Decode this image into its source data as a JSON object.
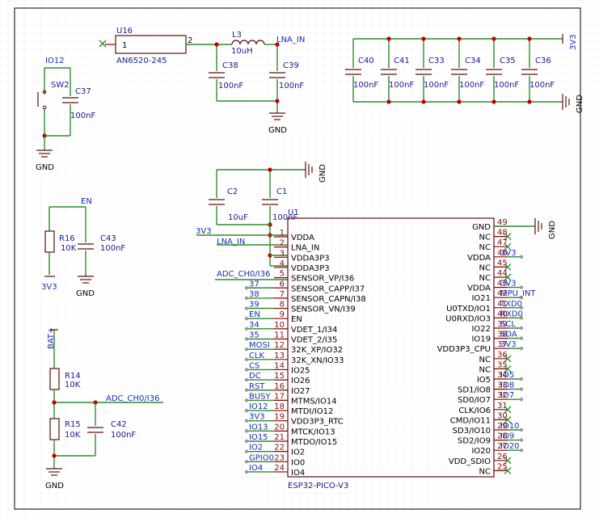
{
  "components": {
    "u16": {
      "ref": "U16",
      "value": "AN6520-245",
      "pin1": "1",
      "pin2": "2"
    },
    "l3": {
      "ref": "L3",
      "value": "10uH"
    },
    "c38": {
      "ref": "C38",
      "value": "100nF"
    },
    "c39": {
      "ref": "C39",
      "value": "100nF"
    },
    "c40": {
      "ref": "C40",
      "value": "100nF"
    },
    "c41": {
      "ref": "C41",
      "value": "100nF"
    },
    "c33": {
      "ref": "C33",
      "value": "100nF"
    },
    "c34": {
      "ref": "C34",
      "value": "100nF"
    },
    "c35": {
      "ref": "C35",
      "value": "100nF"
    },
    "c36": {
      "ref": "C36",
      "value": "100nF"
    },
    "sw2": {
      "ref": "SW2"
    },
    "c37": {
      "ref": "C37",
      "value": "100nF"
    },
    "c2": {
      "ref": "C2",
      "value": "10uF"
    },
    "c1": {
      "ref": "C1",
      "value": "100nF"
    },
    "r16": {
      "ref": "R16",
      "value": "10K"
    },
    "c43": {
      "ref": "C43",
      "value": "100nF"
    },
    "r14": {
      "ref": "R14",
      "value": "10K"
    },
    "r15": {
      "ref": "R15",
      "value": "10K"
    },
    "c42": {
      "ref": "C42",
      "value": "100nF"
    },
    "u1": {
      "ref": "U1",
      "value": "ESP32-PICO-V3"
    }
  },
  "nets": {
    "lna_in": "LNA_IN",
    "v3v3": "3V3",
    "gnd": "GND",
    "io12": "IO12",
    "en": "EN",
    "bat": "BAT+",
    "adc": "ADC_CH0/I36"
  },
  "left_pins": [
    {
      "num": "1",
      "name": "VDDA",
      "net": "3V3"
    },
    {
      "num": "2",
      "name": "LNA_IN",
      "net": "LNA_IN"
    },
    {
      "num": "3",
      "name": "VDDA3P3",
      "net": ""
    },
    {
      "num": "4",
      "name": "VDDA3P3",
      "net": ""
    },
    {
      "num": "5",
      "name": "SENSOR_VP/I36",
      "net": "ADC_CH0/I36"
    },
    {
      "num": "6",
      "name": "SENSOR_CAPP/I37",
      "net": "37"
    },
    {
      "num": "7",
      "name": "SENSOR_CAPN/I38",
      "net": "38"
    },
    {
      "num": "8",
      "name": "SENSOR_VN/I39",
      "net": "39"
    },
    {
      "num": "9",
      "name": "EN",
      "net": "EN"
    },
    {
      "num": "10",
      "name": "VDET_1/I34",
      "net": "34"
    },
    {
      "num": "11",
      "name": "VDET_2/I35",
      "net": "35"
    },
    {
      "num": "12",
      "name": "32K_XP/IO32",
      "net": "MOSI"
    },
    {
      "num": "13",
      "name": "32K_XN/IO33",
      "net": "CLK"
    },
    {
      "num": "14",
      "name": "IO25",
      "net": "CS"
    },
    {
      "num": "15",
      "name": "IO26",
      "net": "DC"
    },
    {
      "num": "16",
      "name": "IO27",
      "net": "RST"
    },
    {
      "num": "17",
      "name": "MTMS/IO14",
      "net": "BUSY"
    },
    {
      "num": "18",
      "name": "MTDI/IO12",
      "net": "IO12"
    },
    {
      "num": "19",
      "name": "VDD3P3_RTC",
      "net": "3V3"
    },
    {
      "num": "20",
      "name": "MTCK/IO13",
      "net": "IO13"
    },
    {
      "num": "21",
      "name": "MTDO/IO15",
      "net": "IO15"
    },
    {
      "num": "22",
      "name": "IO2",
      "net": "IO2"
    },
    {
      "num": "23",
      "name": "IO0",
      "net": "GPIO0"
    },
    {
      "num": "24",
      "name": "IO4",
      "net": "IO4"
    }
  ],
  "right_pins": [
    {
      "num": "49",
      "name": "GND",
      "net": "",
      "nc": false
    },
    {
      "num": "48",
      "name": "NC",
      "net": "",
      "nc": true
    },
    {
      "num": "47",
      "name": "NC",
      "net": "",
      "nc": true
    },
    {
      "num": "46",
      "name": "VDDA",
      "net": "3V3",
      "nc": false
    },
    {
      "num": "45",
      "name": "NC",
      "net": "",
      "nc": true
    },
    {
      "num": "44",
      "name": "NC",
      "net": "",
      "nc": true
    },
    {
      "num": "43",
      "name": "VDDA",
      "net": "3V3",
      "nc": false
    },
    {
      "num": "42",
      "name": "IO21",
      "net": "MPU_INT",
      "nc": false
    },
    {
      "num": "41",
      "name": "U0TXD/IO1",
      "net": "TXD0",
      "nc": false
    },
    {
      "num": "40",
      "name": "U0RXD/IO3",
      "net": "RXD0",
      "nc": false
    },
    {
      "num": "39",
      "name": "IO22",
      "net": "SCL",
      "nc": false
    },
    {
      "num": "38",
      "name": "IO19",
      "net": "SDA",
      "nc": false
    },
    {
      "num": "37",
      "name": "VDD3P3_CPU",
      "net": "3V3",
      "nc": false
    },
    {
      "num": "36",
      "name": "NC",
      "net": "",
      "nc": true
    },
    {
      "num": "35",
      "name": "NC",
      "net": "",
      "nc": true
    },
    {
      "num": "34",
      "name": "IO5",
      "net": "IO5",
      "nc": false
    },
    {
      "num": "33",
      "name": "SD1/IO8",
      "net": "IO8",
      "nc": false
    },
    {
      "num": "32",
      "name": "SD0/IO7",
      "net": "IO7",
      "nc": false
    },
    {
      "num": "31",
      "name": "CLK/IO6",
      "net": "",
      "nc": true
    },
    {
      "num": "30",
      "name": "CMD/IO11",
      "net": "",
      "nc": true
    },
    {
      "num": "29",
      "name": "SD3/IO10",
      "net": "IO10",
      "nc": false
    },
    {
      "num": "28",
      "name": "SD2/IO9",
      "net": "IO9",
      "nc": false
    },
    {
      "num": "27",
      "name": "IO20",
      "net": "IO20",
      "nc": false
    },
    {
      "num": "26",
      "name": "VDD_SDIO",
      "net": "",
      "nc": true
    },
    {
      "num": "25",
      "name": "NC",
      "net": "",
      "nc": true
    }
  ]
}
